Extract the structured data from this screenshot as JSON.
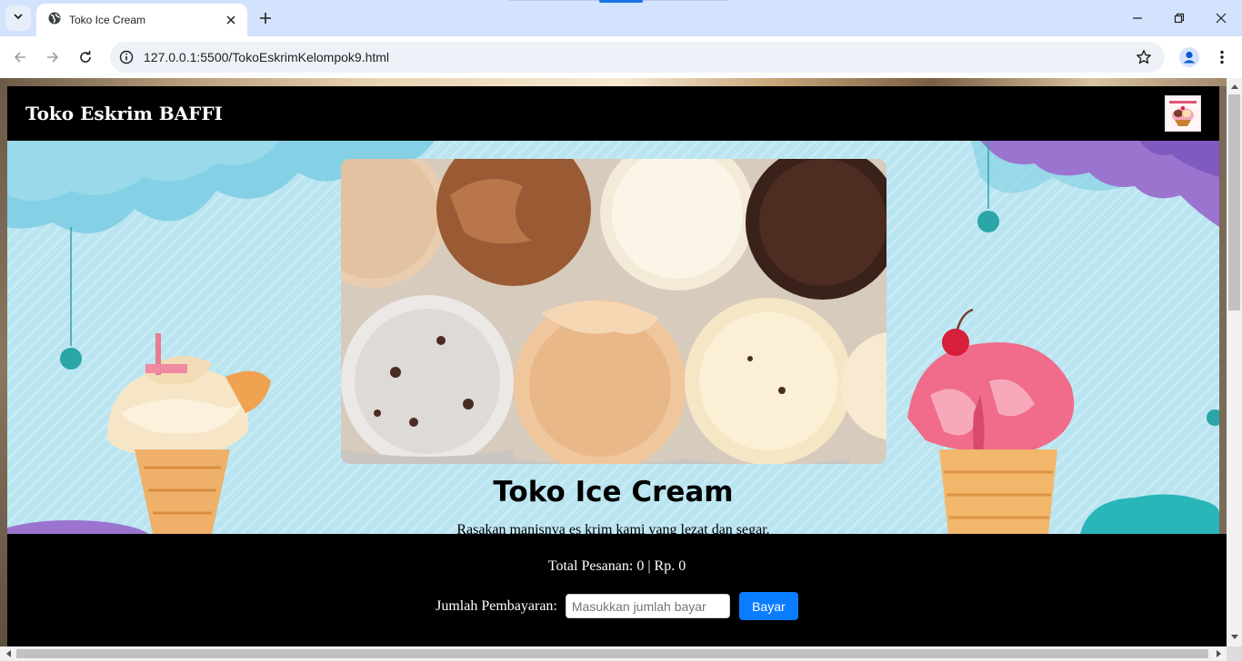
{
  "browser": {
    "tab_title": "Toko Ice Cream",
    "url": "127.0.0.1:5500/TokoEskrimKelompok9.html",
    "accent_color": "#1a73e8"
  },
  "site": {
    "brand": "Toko Eskrim BAFFI",
    "hero_title": "Toko Ice Cream",
    "hero_subtitle": "Rasakan manisnya es krim kami yang lezat dan segar.",
    "order_total": "Total Pesanan: 0 | Rp. 0",
    "payment_label": "Jumlah Pembayaran:",
    "payment_placeholder": "Masukkan jumlah bayar",
    "pay_button": "Bayar",
    "pay_button_color": "#0a7cff",
    "header_color": "#000000"
  },
  "icons": {
    "tab_search": "chevron-down-icon",
    "favicon": "globe-icon",
    "tab_close": "close-icon",
    "new_tab": "plus-icon",
    "back": "arrow-left-icon",
    "forward": "arrow-right-icon",
    "reload": "reload-icon",
    "site_info": "info-icon",
    "bookmark": "star-icon",
    "profile": "person-icon",
    "menu": "kebab-menu-icon",
    "minimize": "minimize-icon",
    "restore": "restore-icon",
    "close_window": "close-icon"
  }
}
